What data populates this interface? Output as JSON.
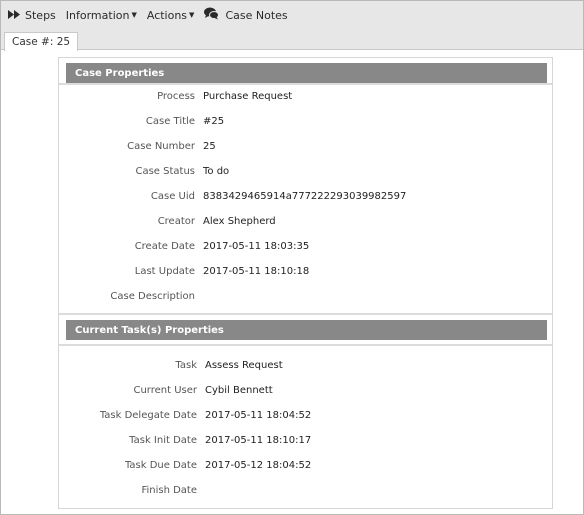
{
  "toolbar": {
    "steps_label": "Steps",
    "information_label": "Information",
    "actions_label": "Actions",
    "case_notes_label": "Case Notes"
  },
  "tabs": [
    {
      "label": "Case #: 25"
    }
  ],
  "case_properties": {
    "title": "Case Properties",
    "fields": [
      {
        "label": "Process",
        "value": "Purchase Request"
      },
      {
        "label": "Case Title",
        "value": "#25"
      },
      {
        "label": "Case Number",
        "value": "25"
      },
      {
        "label": "Case Status",
        "value": "To do"
      },
      {
        "label": "Case Uid",
        "value": "8383429465914a777222293039982597"
      },
      {
        "label": "Creator",
        "value": "Alex Shepherd"
      },
      {
        "label": "Create Date",
        "value": "2017-05-11 18:03:35"
      },
      {
        "label": "Last Update",
        "value": "2017-05-11 18:10:18"
      },
      {
        "label": "Case Description",
        "value": ""
      }
    ]
  },
  "task_properties": {
    "title": "Current Task(s) Properties",
    "fields": [
      {
        "label": "Task",
        "value": "Assess Request"
      },
      {
        "label": "Current User",
        "value": "Cybil Bennett"
      },
      {
        "label": "Task Delegate Date",
        "value": "2017-05-11 18:04:52"
      },
      {
        "label": "Task Init Date",
        "value": "2017-05-11 18:10:17"
      },
      {
        "label": "Task Due Date",
        "value": "2017-05-12 18:04:52"
      },
      {
        "label": "Finish Date",
        "value": ""
      }
    ]
  }
}
